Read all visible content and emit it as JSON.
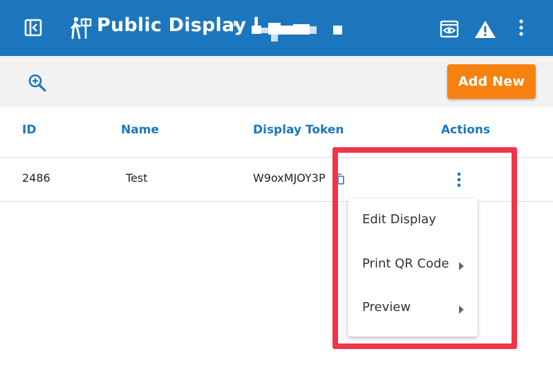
{
  "appbar": {
    "title": "Public Display l"
  },
  "toolbar": {
    "add_new_label": "Add New"
  },
  "table": {
    "headers": {
      "id": "ID",
      "name": "Name",
      "token": "Display Token",
      "actions": "Actions"
    },
    "rows": [
      {
        "id": "2486",
        "name": "Test",
        "token": "W9oxMJOY3P"
      }
    ]
  },
  "menu": {
    "items": [
      {
        "label": "Edit Display",
        "has_submenu": false
      },
      {
        "label": "Print QR Code",
        "has_submenu": true
      },
      {
        "label": "Preview",
        "has_submenu": true
      }
    ]
  },
  "colors": {
    "primary": "#1b76bd",
    "accent": "#f7810f",
    "highlight": "#f13448"
  },
  "icons": {
    "sidebar_toggle": "sidebar-toggle-icon",
    "app": "hiking-signpost-icon",
    "preview": "preview-eye-icon",
    "warning": "warning-icon",
    "more": "more-vertical-icon",
    "search": "zoom-in-icon",
    "copy": "copy-icon"
  }
}
